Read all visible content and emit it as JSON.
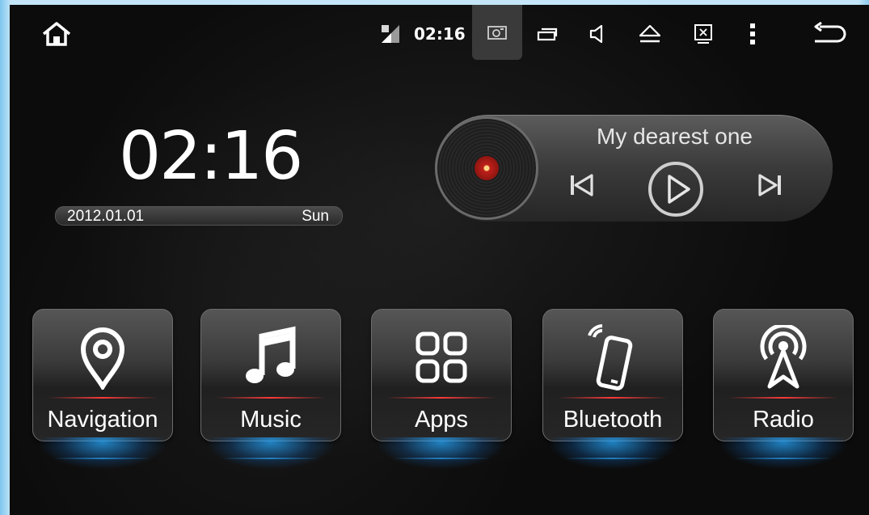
{
  "status_bar": {
    "time": "02:16",
    "icons": [
      "home-icon",
      "signal-icon",
      "screenshot-icon",
      "recent-apps-icon",
      "volume-icon",
      "eject-icon",
      "close-app-icon",
      "menu-icon",
      "back-icon"
    ]
  },
  "clock_widget": {
    "time": "02:16",
    "date": "2012.01.01",
    "day": "Sun"
  },
  "music_widget": {
    "song_title": "My dearest one",
    "controls": [
      "prev-icon",
      "play-icon",
      "next-icon"
    ]
  },
  "apps": [
    {
      "label": "Navigation",
      "icon": "location-pin-icon"
    },
    {
      "label": "Music",
      "icon": "music-note-icon"
    },
    {
      "label": "Apps",
      "icon": "apps-grid-icon"
    },
    {
      "label": "Bluetooth",
      "icon": "phone-icon"
    },
    {
      "label": "Radio",
      "icon": "radio-tower-icon"
    }
  ],
  "colors": {
    "background": "#0c0c0c",
    "accent_red": "#ff3a3a",
    "glow_blue": "#28aaff",
    "frame_blue": "#c4e6f8"
  }
}
